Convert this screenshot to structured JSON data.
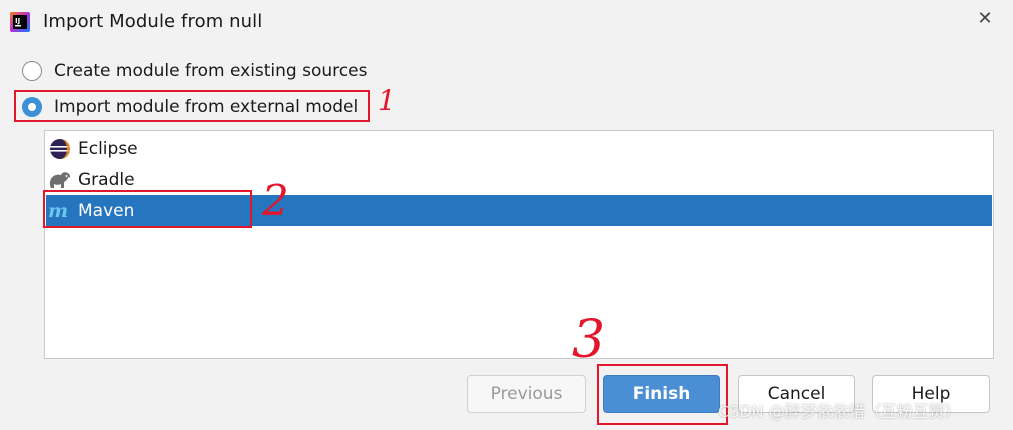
{
  "window": {
    "title": "Import Module from null",
    "close_glyph": "✕"
  },
  "options": [
    {
      "label": "Create module from existing sources",
      "selected": false
    },
    {
      "label": "Import module from external model",
      "selected": true
    }
  ],
  "models": [
    {
      "label": "Eclipse",
      "icon": "eclipse-icon",
      "selected": false
    },
    {
      "label": "Gradle",
      "icon": "gradle-elephant-icon",
      "selected": false
    },
    {
      "label": "Maven",
      "icon": "maven-icon",
      "selected": true
    }
  ],
  "buttons": {
    "previous": "Previous",
    "finish": "Finish",
    "cancel": "Cancel",
    "help": "Help"
  },
  "annotations": {
    "step1": "1",
    "step2": "2",
    "step3": "3",
    "color": "#e3172b"
  },
  "watermark": "CSDN @醉梦依依惜（互粉互赞）",
  "colors": {
    "selection": "#2675bf",
    "primary_button": "#4a8fd4",
    "radio_checked": "#3d8fd6"
  }
}
